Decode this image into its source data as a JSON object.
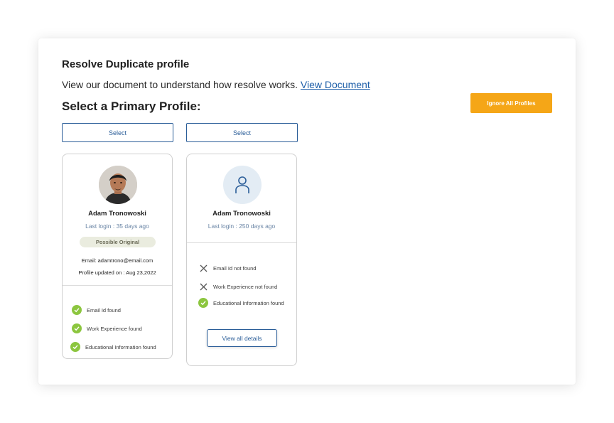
{
  "header": {
    "title": "Resolve Duplicate profile",
    "subtitle_text": "View our document to understand how resolve works.",
    "subtitle_link": "View Document",
    "section_title": "Select a Primary Profile:",
    "ignore_button": "Ignore All Profiles"
  },
  "colors": {
    "accent": "#f5a617",
    "link": "#1d5ea8",
    "primary": "#2a5d98",
    "check": "#8cc63f"
  },
  "profiles": [
    {
      "select_label": "Select",
      "avatar_icon": "user-photo",
      "name": "Adam Tronowoski",
      "last_login": "Last login : 35 days ago",
      "badge": "Possible Original",
      "email": "Email: adamtrono@email.com",
      "updated": "Profile updated on : Aug 23,2022",
      "checks": [
        {
          "label": "Email Id found",
          "status": "found"
        },
        {
          "label": "Work Experience found",
          "status": "found"
        },
        {
          "label": "Educational Information found",
          "status": "found"
        }
      ]
    },
    {
      "select_label": "Select",
      "avatar_icon": "user-placeholder-icon",
      "name": "Adam Tronowoski",
      "last_login": "Last login : 250 days ago",
      "checks": [
        {
          "label": "Email Id not found",
          "status": "missing"
        },
        {
          "label": "Work Experience not found",
          "status": "missing"
        },
        {
          "label": "Educational Information found",
          "status": "found"
        }
      ],
      "view_button": "View all details"
    }
  ]
}
